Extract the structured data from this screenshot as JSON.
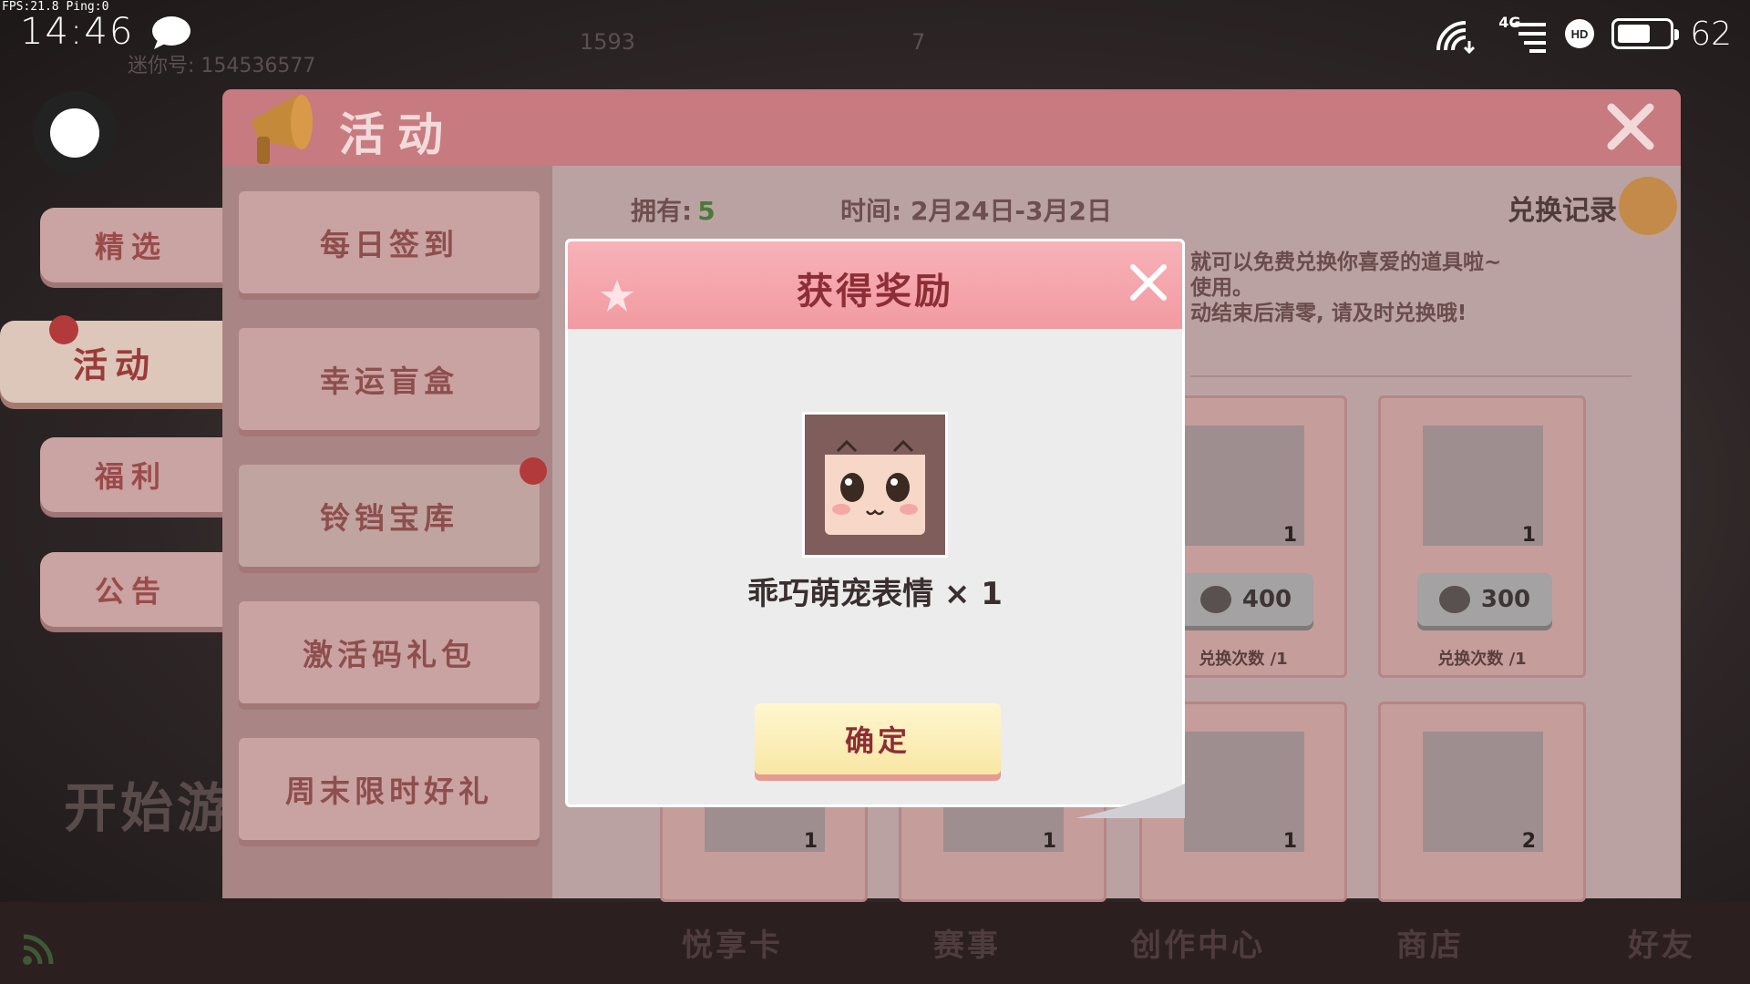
{
  "status": {
    "fps": "FPS:21.8  Ping:0",
    "time": "14:46",
    "network": "4G",
    "battery": "62",
    "battery_level_percent": 62,
    "bg_user": "迷你号: 154536577",
    "bg_coins": "1593",
    "bg_gems": "7"
  },
  "nav": {
    "items": [
      {
        "label": "精选"
      },
      {
        "label": "活动"
      },
      {
        "label": "福利"
      },
      {
        "label": "公告"
      }
    ],
    "start_game": "开始游"
  },
  "panel": {
    "title": "活动",
    "side_buttons": [
      {
        "label": "每日签到"
      },
      {
        "label": "幸运盲盒"
      },
      {
        "label": "铃铛宝库"
      },
      {
        "label": "激活码礼包"
      },
      {
        "label": "周末限时好礼"
      }
    ],
    "own_label": "拥有:",
    "own_value": "5",
    "time_label": "时间: 2月24日-3月2日",
    "record_label": "兑换记录",
    "desc_lines": [
      "就可以免费兑换你喜爱的道具啦~",
      "使用。",
      "动结束后清零, 请及时兑换哦!"
    ],
    "cards": [
      {
        "qty": "1",
        "price": "400",
        "limit": "兑换次数 /1"
      },
      {
        "qty": "1",
        "price": "300",
        "limit": "兑换次数 /1"
      },
      {
        "qty": "1"
      },
      {
        "qty": "1"
      },
      {
        "qty": "1"
      },
      {
        "qty": "2"
      }
    ]
  },
  "bottom": {
    "items": [
      {
        "label": "悦享卡"
      },
      {
        "label": "赛事"
      },
      {
        "label": "创作中心"
      },
      {
        "label": "商店"
      },
      {
        "label": "好友"
      }
    ]
  },
  "modal": {
    "title": "获得奖励",
    "reward_name": "乖巧萌宠表情 × 1",
    "confirm_label": "确定"
  },
  "colors": {
    "accent_red": "#8d2d35",
    "header_pink": "#f29aa1",
    "confirm_yellow": "#f8e7a4",
    "own_green": "#4b7a3a"
  }
}
